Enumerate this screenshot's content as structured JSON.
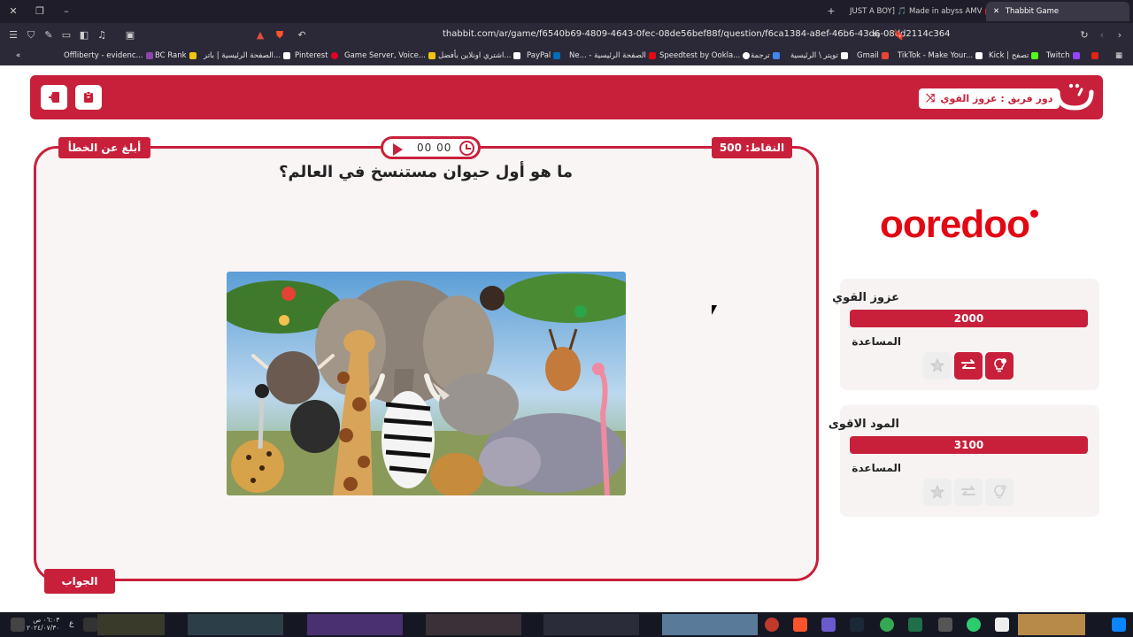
{
  "browser": {
    "tabs": [
      {
        "label": "JUST A BOY] 🎵 Made in abyss AMV"
      },
      {
        "label": "Thabbit Game"
      }
    ],
    "url": "thabbit.com/ar/game/f6540b69-4809-4643-0fec-08de56bef88f/question/f6ca1384-a8ef-46b6-43d6-08dd2114c364",
    "bookmarks": [
      {
        "label": "Offliberty - evidenc...",
        "color": "#8e44ad"
      },
      {
        "label": "BC Rank",
        "color": "#f1c40f"
      },
      {
        "label": "الصفحة الرئيسية | باتر...",
        "color": "#ffffff"
      },
      {
        "label": "Pinterest",
        "color": "#e60023"
      },
      {
        "label": "Game Server, Voice...",
        "color": "#f1c40f"
      },
      {
        "label": "اشتري اونلاين بأفضل...",
        "color": "#ffffff"
      },
      {
        "label": "PayPal",
        "color": "#0070ba"
      },
      {
        "label": "Ne... - الصفحة الرئيسية",
        "color": "#e50914"
      },
      {
        "label": "Speedtest by Ookla...",
        "color": "#ffffff"
      },
      {
        "label": "ترجمة",
        "color": "#4285f4"
      },
      {
        "label": "تويتر \\ الرئيسية",
        "color": "#ffffff"
      },
      {
        "label": "Gmail",
        "color": "#ea4335"
      },
      {
        "label": "TikTok - Make Your...",
        "color": "#ffffff"
      },
      {
        "label": "Kick | تصفح",
        "color": "#53fc18"
      },
      {
        "label": "Twitch",
        "color": "#9146ff"
      }
    ]
  },
  "game": {
    "turn_label": "دور فريق : عزوز القوي",
    "report_label": "أبلغ عن الخطأ",
    "points_label": "النقاط: 500",
    "timer": "00 00",
    "question": "ما هو أول حيوان مستنسخ في العالم؟",
    "answer_label": "الجواب",
    "image_alt": "animals-collage"
  },
  "sponsor": {
    "name": "ooredoo"
  },
  "teams": [
    {
      "name": "عزوز القوي",
      "score": "2000",
      "help_label": "المساعدة",
      "aids_active": [
        false,
        true,
        true
      ]
    },
    {
      "name": "المود الاقوى",
      "score": "3100",
      "help_label": "المساعدة",
      "aids_active": [
        false,
        false,
        false
      ]
    }
  ],
  "taskbar": {
    "time": "٠٦:٠٣ ص",
    "date": "٢٠٢٤/٠٧/٣٠",
    "lang": "ع"
  },
  "colors": {
    "accent": "#c8203b",
    "sponsor": "#e30613"
  }
}
